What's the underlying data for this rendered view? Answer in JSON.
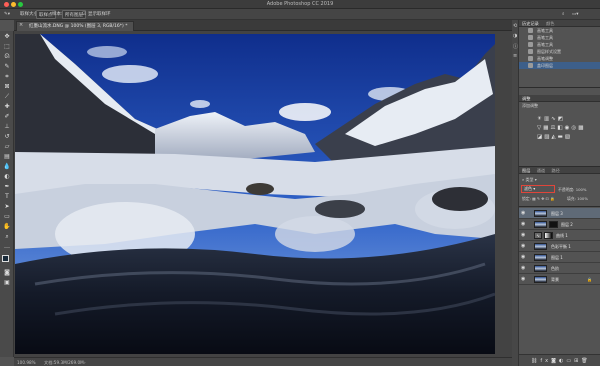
{
  "window": {
    "title": "Adobe Photoshop CC 2019"
  },
  "options_bar": {
    "sample_size_label": "取样大小:",
    "sample_size_value": "取样点",
    "sample_label": "样本:",
    "sample_value": "所有图层",
    "show_ring_label": "显示取样环"
  },
  "document_tab": {
    "label": "红墨山流水.DNG @ 100% (图层 3, RGB/16*) *",
    "close": "×"
  },
  "status_bar": {
    "zoom": "100.98%",
    "doc_size": "文档:59.3M/269.0M"
  },
  "panels": {
    "history": {
      "tabs": [
        "历史记录",
        "颜色"
      ],
      "items": [
        "画笔工具",
        "画笔工具",
        "画笔工具",
        "图层样式设置",
        "画笔调整",
        "盖印图层"
      ],
      "selected_index": 5
    },
    "adjustments": {
      "title": "调整",
      "subtitle": "添加调整"
    },
    "layers": {
      "tabs": [
        "图层",
        "通道",
        "路径"
      ],
      "kind_label": "类型",
      "blend_mode": "滤色",
      "opacity_label": "不透明度:",
      "opacity_value": "100%",
      "lock_label": "锁定:",
      "fill_label": "填充:",
      "fill_value": "100%",
      "rows": [
        {
          "name": "图层 3",
          "has_mask": false,
          "selected": true
        },
        {
          "name": "图层 2",
          "has_mask": true,
          "selected": false
        },
        {
          "name": "曲线 1",
          "has_mask": true,
          "selected": false
        },
        {
          "name": "色彩平衡 1",
          "has_mask": false,
          "selected": false
        },
        {
          "name": "图层 1",
          "has_mask": false,
          "selected": false
        },
        {
          "name": "色阶",
          "has_mask": false,
          "selected": false
        },
        {
          "name": "背景",
          "has_mask": false,
          "selected": false
        }
      ]
    }
  },
  "colors": {
    "highlight_box": "#e0453a",
    "selection_blue": "#3d5f8a"
  }
}
